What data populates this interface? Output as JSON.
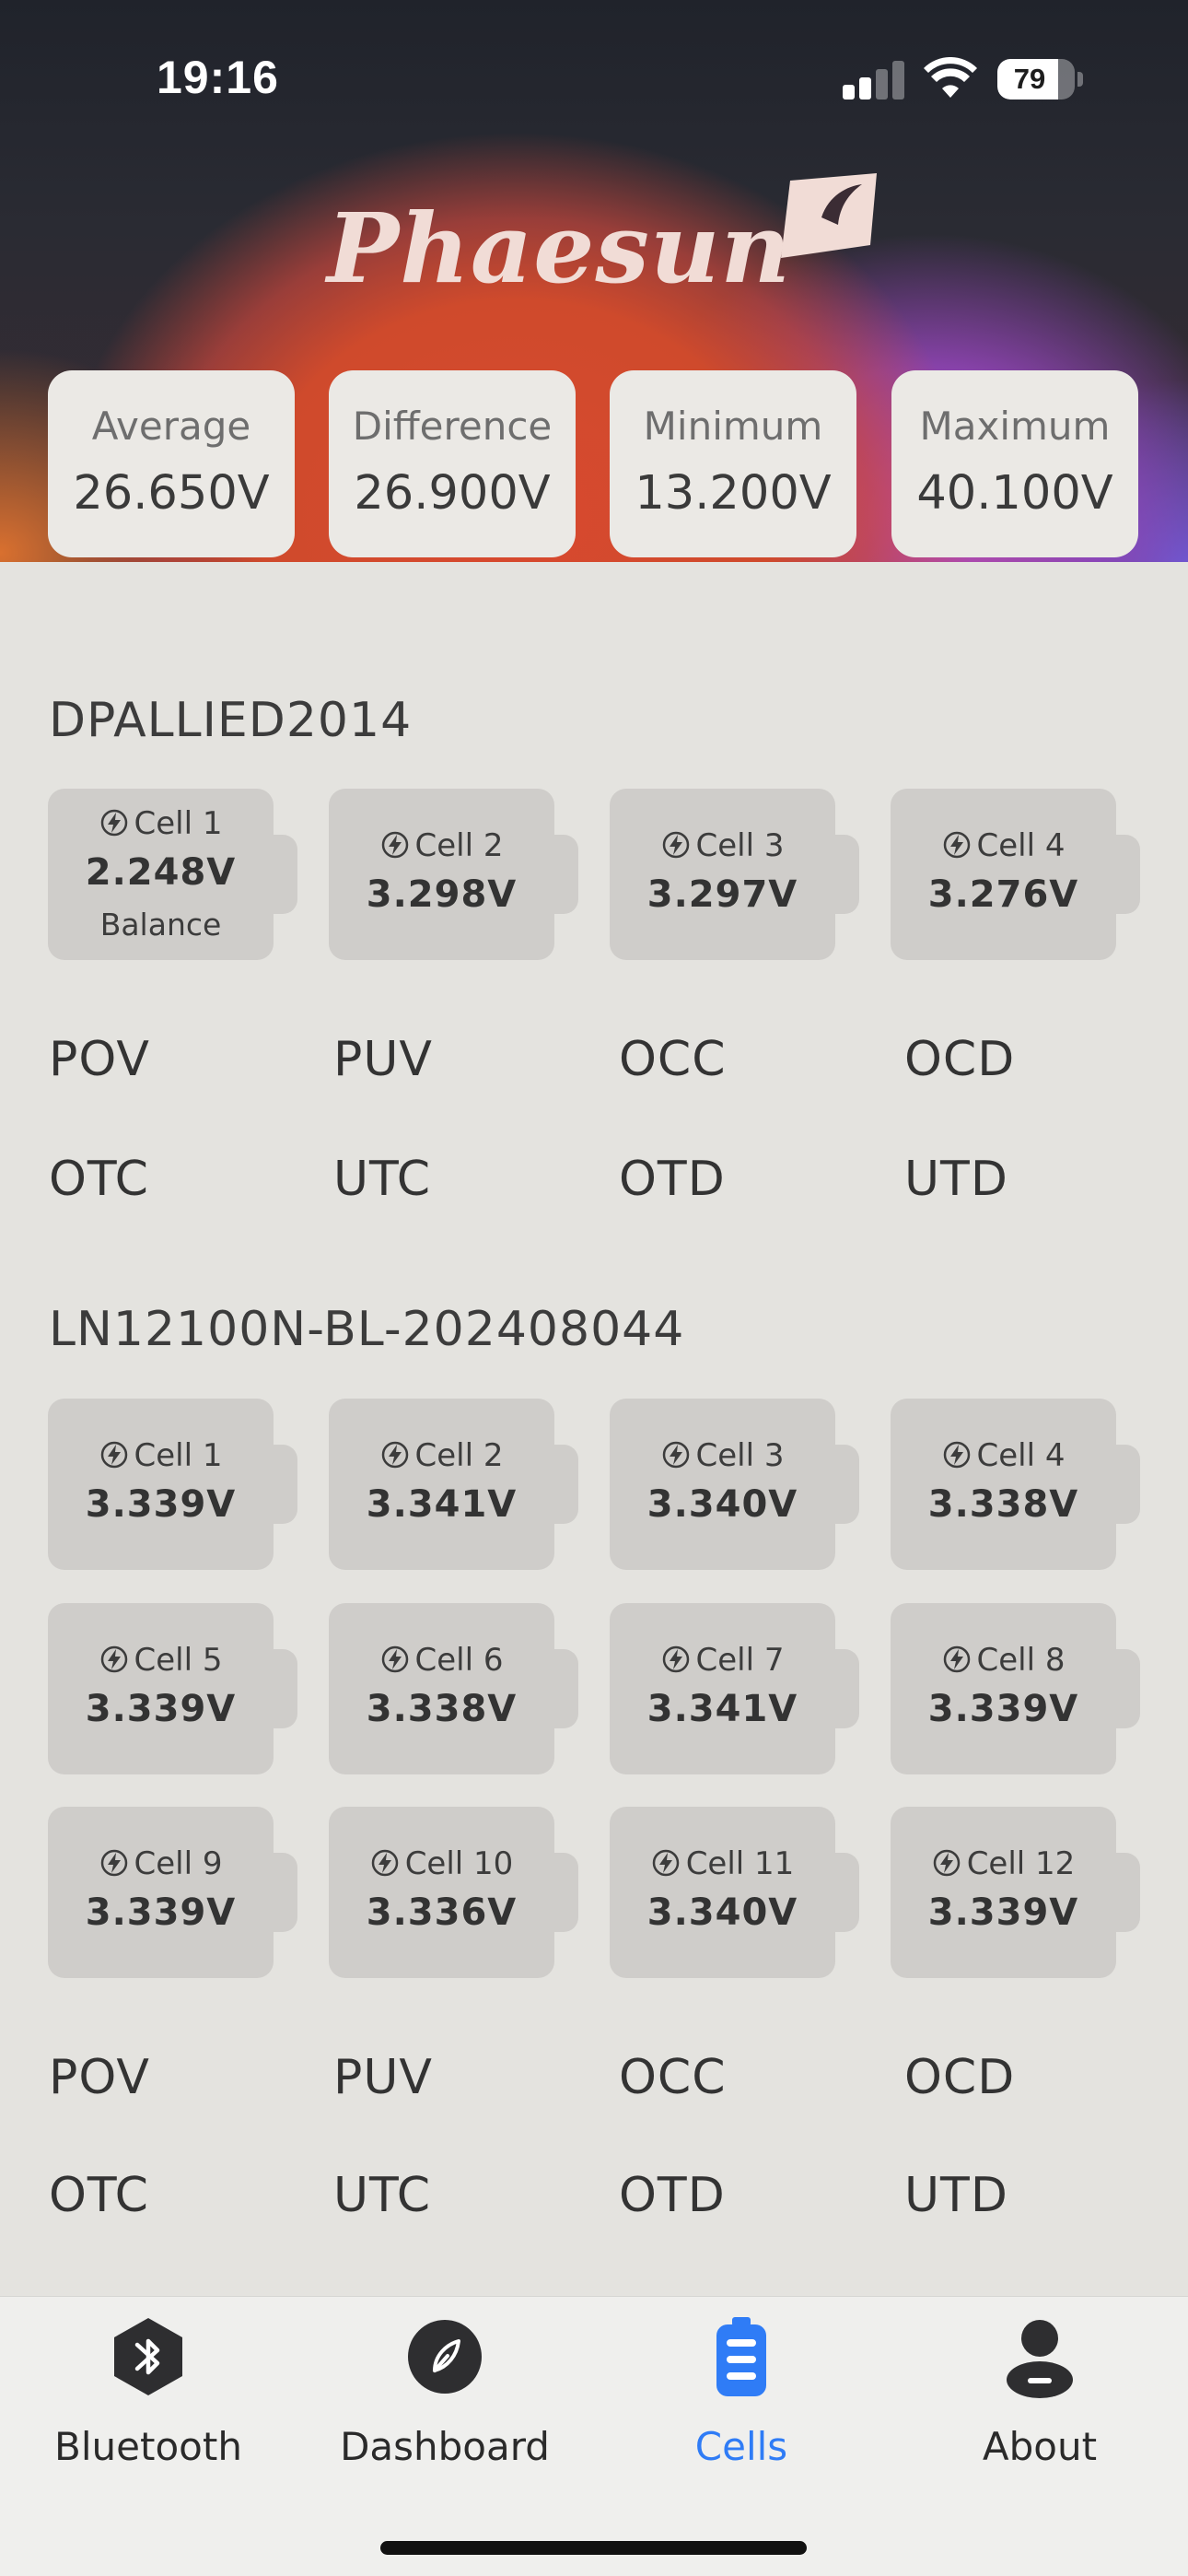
{
  "status_bar": {
    "time": "19:16",
    "battery": "79",
    "battery_level": 0.79,
    "signal_bars": 2
  },
  "header": {
    "brand": "Phaesun"
  },
  "stats": [
    {
      "label": "Average",
      "value": "26.650V"
    },
    {
      "label": "Difference",
      "value": "26.900V"
    },
    {
      "label": "Minimum",
      "value": "13.200V"
    },
    {
      "label": "Maximum",
      "value": "40.100V"
    }
  ],
  "packs": [
    {
      "name": "DPALLIED2014",
      "cells": [
        {
          "label": "Cell 1",
          "voltage": "2.248V",
          "status": "Balance"
        },
        {
          "label": "Cell 2",
          "voltage": "3.298V",
          "status": ""
        },
        {
          "label": "Cell 3",
          "voltage": "3.297V",
          "status": ""
        },
        {
          "label": "Cell 4",
          "voltage": "3.276V",
          "status": ""
        }
      ],
      "flags": [
        "POV",
        "PUV",
        "OCC",
        "OCD",
        "OTC",
        "UTC",
        "OTD",
        "UTD"
      ]
    },
    {
      "name": "LN12100N-BL-202408044",
      "cells": [
        {
          "label": "Cell 1",
          "voltage": "3.339V",
          "status": ""
        },
        {
          "label": "Cell 2",
          "voltage": "3.341V",
          "status": ""
        },
        {
          "label": "Cell 3",
          "voltage": "3.340V",
          "status": ""
        },
        {
          "label": "Cell 4",
          "voltage": "3.338V",
          "status": ""
        },
        {
          "label": "Cell 5",
          "voltage": "3.339V",
          "status": ""
        },
        {
          "label": "Cell 6",
          "voltage": "3.338V",
          "status": ""
        },
        {
          "label": "Cell 7",
          "voltage": "3.341V",
          "status": ""
        },
        {
          "label": "Cell 8",
          "voltage": "3.339V",
          "status": ""
        },
        {
          "label": "Cell 9",
          "voltage": "3.339V",
          "status": ""
        },
        {
          "label": "Cell 10",
          "voltage": "3.336V",
          "status": ""
        },
        {
          "label": "Cell 11",
          "voltage": "3.340V",
          "status": ""
        },
        {
          "label": "Cell 12",
          "voltage": "3.339V",
          "status": ""
        }
      ],
      "flags": [
        "POV",
        "PUV",
        "OCC",
        "OCD",
        "OTC",
        "UTC",
        "OTD",
        "UTD"
      ]
    }
  ],
  "tabs": [
    {
      "label": "Bluetooth",
      "icon": "bluetooth-icon",
      "active": false
    },
    {
      "label": "Dashboard",
      "icon": "dashboard-icon",
      "active": false
    },
    {
      "label": "Cells",
      "icon": "battery-icon",
      "active": true
    },
    {
      "label": "About",
      "icon": "person-icon",
      "active": false
    }
  ],
  "colors": {
    "accent": "#2f7cf6",
    "card": "#cfcdca",
    "background": "#e4e3df"
  }
}
